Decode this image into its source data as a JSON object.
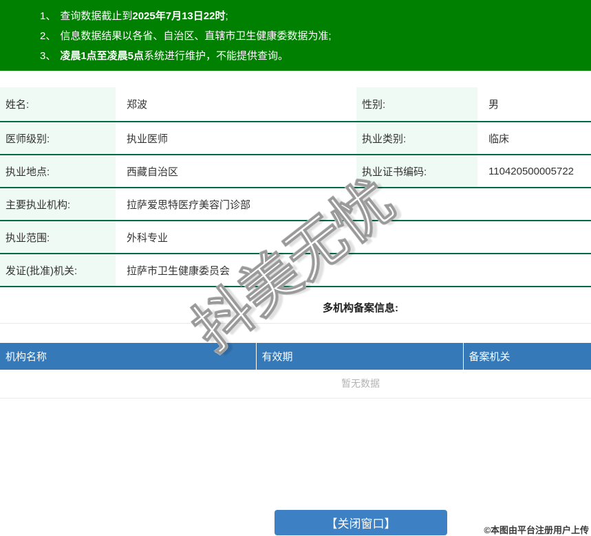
{
  "notice": {
    "lines": [
      {
        "num": "1、",
        "pre": "查询数据截止到",
        "bold": "2025年7月13日22时",
        "post": ";"
      },
      {
        "num": "2、",
        "pre": "信息数据结果以各省、自治区、直辖市卫生健康委数据为准;",
        "bold": "",
        "post": ""
      },
      {
        "num": "3、",
        "pre": "",
        "bold": "凌晨1点至凌晨5点",
        "post": "系统进行维护，不能提供查询。"
      }
    ]
  },
  "doctor": {
    "name_label": "姓名:",
    "name": "郑波",
    "gender_label": "性别:",
    "gender": "男",
    "level_label": "医师级别:",
    "level": "执业医师",
    "category_label": "执业类别:",
    "category": "临床",
    "location_label": "执业地点:",
    "location": "西藏自治区",
    "cert_no_label": "执业证书编码:",
    "cert_no": "110420500005722",
    "main_org_label": "主要执业机构:",
    "main_org": "拉萨爱思特医疗美容门诊部",
    "scope_label": "执业范围:",
    "scope": "外科专业",
    "issuer_label": "发证(批准)机关:",
    "issuer": "拉萨市卫生健康委员会"
  },
  "multi_org": {
    "title": "多机构备案信息:",
    "columns": [
      "机构名称",
      "有效期",
      "备案机关"
    ],
    "empty_text": "暂无数据"
  },
  "footer": {
    "close_button": "【关闭窗口】",
    "copyright": "©本图由平台注册用户上传"
  },
  "watermark": "抖美无忧",
  "colors": {
    "notice-bg": "#008000",
    "row-border": "#006945",
    "label-bg": "#effaf4",
    "thead-bg": "#3579b8",
    "button-bg": "#3d81c4",
    "muted": "#b3b3b3",
    "light-border": "#e9e9e9",
    "text": "#333333"
  }
}
